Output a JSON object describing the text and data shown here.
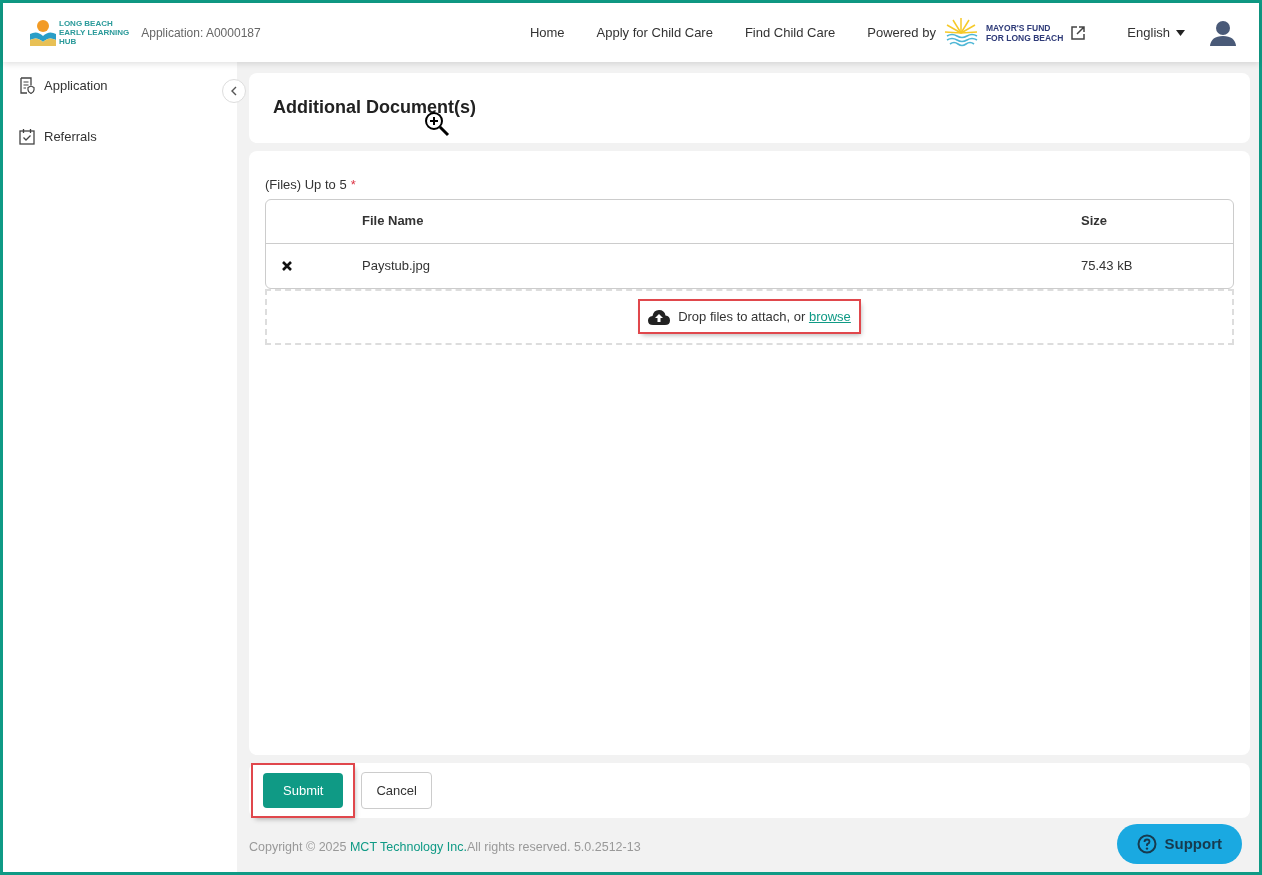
{
  "header": {
    "logo_lines": [
      "LONG BEACH",
      "EARLY LEARNING",
      "HUB"
    ],
    "application": "Application: A0000187",
    "nav": [
      "Home",
      "Apply for Child Care",
      "Find Child Care"
    ],
    "powered_by": "Powered by",
    "partner_lines": [
      "MAYOR'S FUND",
      "FOR LONG BEACH"
    ],
    "language": "English"
  },
  "sidebar": {
    "items": [
      {
        "label": "Application",
        "kind": "document",
        "selected": false
      },
      {
        "label": "Referrals",
        "kind": "calendar",
        "selected": false
      }
    ]
  },
  "page_title": "Additional Document(s)",
  "files": {
    "label": "(Files) Up to 5",
    "required_mark": "*",
    "columns": [
      "File Name",
      "Size"
    ],
    "rows": [
      {
        "name": "Paystub.jpg",
        "size": "75.43 kB"
      }
    ],
    "dropzone": {
      "text": "Drop files to attach, or ",
      "link": "browse",
      "highlighted": true
    }
  },
  "buttons": [
    {
      "label": "Submit",
      "kind": "primary",
      "highlighted": true
    },
    {
      "label": "Cancel",
      "kind": "secondary",
      "highlighted": false
    }
  ],
  "footer": {
    "copyright": "Copyright © 2025 ",
    "company": "MCT Technology Inc.",
    "rights": "All rights reserved. 5.0.2512-13"
  },
  "support": "Support"
}
